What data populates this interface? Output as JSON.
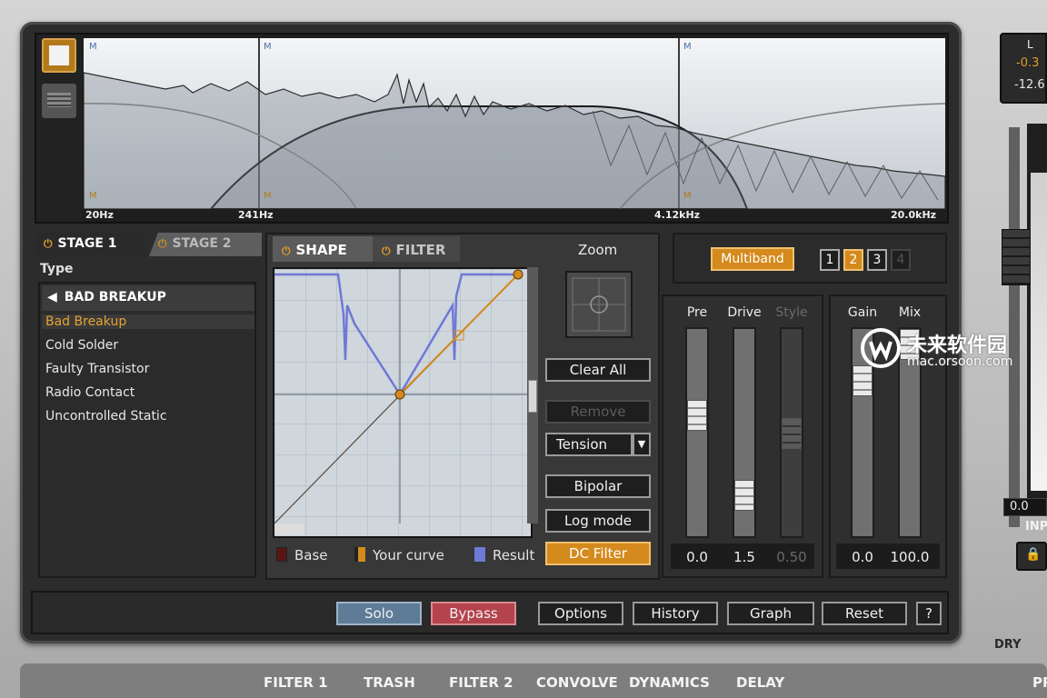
{
  "spectrum": {
    "freq_labels": [
      "20Hz",
      "241Hz",
      "4.12kHz",
      "20.0kHz"
    ],
    "band_markers": {
      "m": "M"
    }
  },
  "stages": {
    "stage1": "STAGE 1",
    "stage2": "STAGE 2",
    "power_glyph": "⏻"
  },
  "type_list": {
    "label": "Type",
    "header": "BAD BREAKUP",
    "back_arrow": "◀",
    "items": [
      "Bad Breakup",
      "Cold Solder",
      "Faulty Transistor",
      "Radio Contact",
      "Uncontrolled Static"
    ],
    "selected_index": 0
  },
  "shape": {
    "tab_shape": "SHAPE",
    "tab_filter": "FILTER",
    "zoom": "Zoom",
    "buttons": {
      "clear_all": "Clear All",
      "remove": "Remove",
      "tension": "Tension",
      "tension_arrow": "▼",
      "bipolar": "Bipolar",
      "log_mode": "Log mode",
      "dc_filter": "DC Filter"
    },
    "legend": [
      {
        "label": "Base",
        "color": "#5a1515"
      },
      {
        "label": "Your curve",
        "color": "#d48a1d"
      },
      {
        "label": "Result",
        "color": "#6f79d6"
      }
    ]
  },
  "multiband": {
    "label": "Multiband",
    "bands": [
      "1",
      "2",
      "3",
      "4"
    ],
    "active_band": "2"
  },
  "sliders": {
    "pre": {
      "label": "Pre",
      "value": "0.0"
    },
    "drive": {
      "label": "Drive",
      "value": "1.5"
    },
    "style": {
      "label": "Style",
      "value": "0.50"
    },
    "gain": {
      "label": "Gain",
      "value": "0.0"
    },
    "mix": {
      "label": "Mix",
      "value": "100.0"
    }
  },
  "bottom_bar": {
    "solo": "Solo",
    "bypass": "Bypass",
    "options": "Options",
    "history": "History",
    "graph": "Graph",
    "reset": "Reset",
    "help": "?"
  },
  "modules": [
    "FILTER 1",
    "TRASH",
    "FILTER 2",
    "CONVOLVE",
    "DYNAMICS",
    "DELAY"
  ],
  "meter": {
    "channel": "L",
    "peak": "-0.3",
    "rms": "-12.6",
    "output_readout": "0.0",
    "input_label": "INP",
    "dry_label": "DRY",
    "preset_label": "PR",
    "lock_glyph": "🔒"
  },
  "watermark": {
    "cn": "未来软件园",
    "url": "mac.orsoon.com"
  },
  "colors": {
    "accent": "#d48a1d",
    "solo": "#5e7c98",
    "bypass": "#b4434e",
    "panel": "#2c2c2c"
  }
}
